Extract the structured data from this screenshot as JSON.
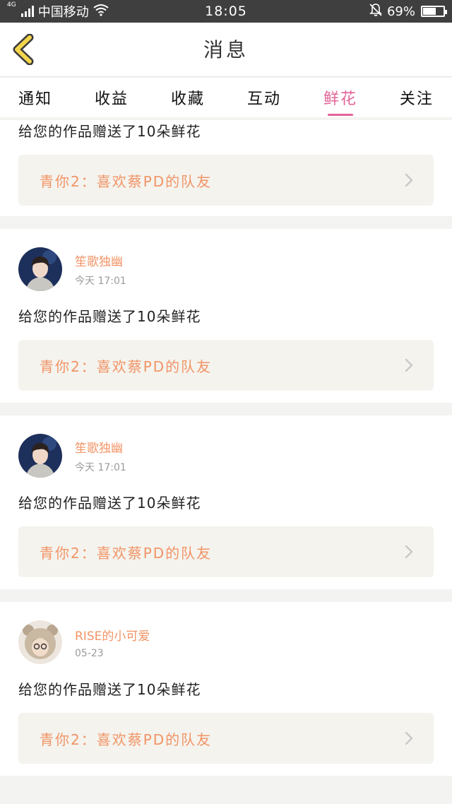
{
  "status_bar": {
    "network": "4G",
    "carrier": "中国移动",
    "time": "18:05",
    "battery": "69%",
    "battery_level": 0.69
  },
  "header": {
    "title": "消息"
  },
  "tabs": [
    {
      "label": "通知",
      "active": false
    },
    {
      "label": "收益",
      "active": false
    },
    {
      "label": "收藏",
      "active": false
    },
    {
      "label": "互动",
      "active": false
    },
    {
      "label": "鲜花",
      "active": true
    },
    {
      "label": "关注",
      "active": false
    }
  ],
  "colors": {
    "accent": "#e26499",
    "username": "#f29466",
    "card_inner": "#f4f3ee",
    "background": "#f3f3f1",
    "status_bar": "#3f3f3f"
  },
  "feed": [
    {
      "partial": true,
      "message": "给您的作品赠送了10朵鲜花",
      "work_title": "青你2：喜欢蔡PD的队友"
    },
    {
      "username": "笙歌独幽",
      "time": "今天 17:01",
      "avatar": "avatar-boy",
      "message": "给您的作品赠送了10朵鲜花",
      "work_title": "青你2：喜欢蔡PD的队友"
    },
    {
      "username": "笙歌独幽",
      "time": "今天 17:01",
      "avatar": "avatar-boy",
      "message": "给您的作品赠送了10朵鲜花",
      "work_title": "青你2：喜欢蔡PD的队友"
    },
    {
      "username": "RISE的小可爱",
      "time": "05-23",
      "avatar": "avatar-bear-hood",
      "message": "给您的作品赠送了10朵鲜花",
      "work_title": "青你2：喜欢蔡PD的队友"
    }
  ]
}
